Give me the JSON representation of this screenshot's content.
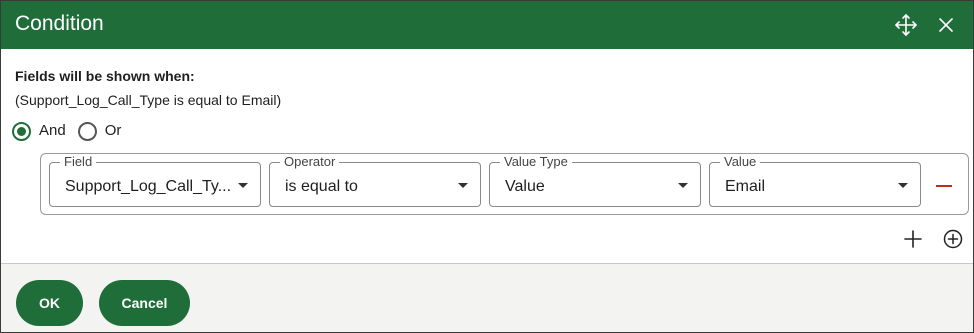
{
  "dialog": {
    "title": "Condition",
    "move_icon": "move-arrows-icon",
    "close_icon": "close-icon"
  },
  "condition": {
    "heading": "Fields will be shown when:",
    "expression": "(Support_Log_Call_Type is equal to Email)",
    "logic": {
      "options": [
        {
          "label": "And",
          "selected": true
        },
        {
          "label": "Or",
          "selected": false
        }
      ]
    },
    "row": {
      "field": {
        "label": "Field",
        "value": "Support_Log_Call_Ty..."
      },
      "operator": {
        "label": "Operator",
        "value": "is equal to"
      },
      "value_type": {
        "label": "Value Type",
        "value": "Value"
      },
      "value": {
        "label": "Value",
        "value": "Email"
      },
      "remove_icon": "remove-icon",
      "remove_color": "#c62828"
    },
    "add_icon": "plus-icon",
    "add_group_icon": "plus-circle-icon"
  },
  "footer": {
    "ok_label": "OK",
    "cancel_label": "Cancel"
  },
  "colors": {
    "accent": "#1f6e3a",
    "footer_bg": "#f3f3f1"
  }
}
